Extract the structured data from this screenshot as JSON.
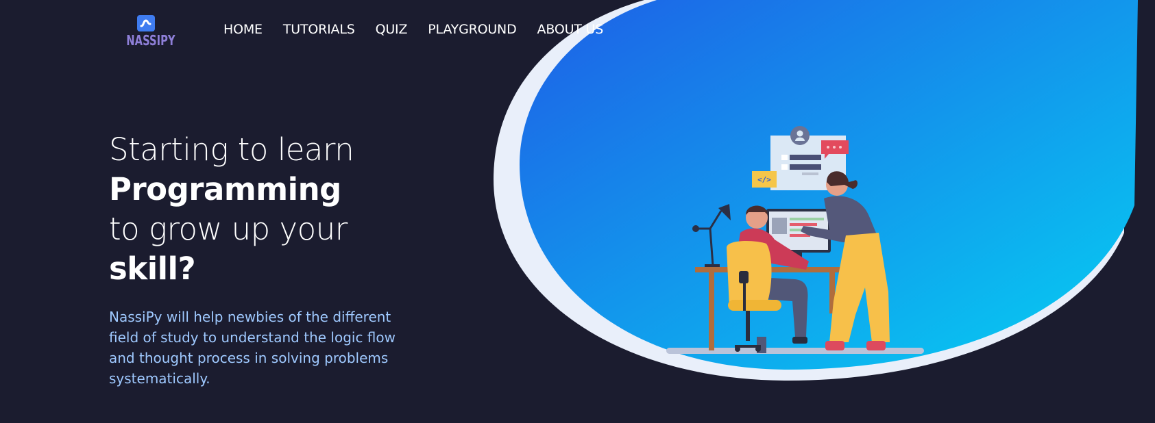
{
  "logo": {
    "text": "NASSIPY"
  },
  "nav": {
    "items": [
      {
        "label": "HOME"
      },
      {
        "label": "TUTORIALS"
      },
      {
        "label": "QUIZ"
      },
      {
        "label": "PLAYGROUND"
      },
      {
        "label": "ABOUT US"
      }
    ]
  },
  "hero": {
    "line1": "Starting to learn",
    "line2": "Programming",
    "line3_prefix": "to grow up your",
    "line3_strong": "skill?",
    "description": "NassiPy will help newbies of the different field of study to understand the logic flow and thought process in solving problems systematically."
  },
  "illustration": {
    "code_badge": "</>",
    "icons": [
      "user-profile-icon",
      "chat-bubble-icon",
      "desk-lamp-icon",
      "office-chair-icon"
    ]
  },
  "colors": {
    "background": "#1b1c2f",
    "accent_blue": "#3f7cf0",
    "gradient_start": "#1e5fe6",
    "gradient_end": "#06c8f2",
    "description_text": "#9fc9ff"
  }
}
